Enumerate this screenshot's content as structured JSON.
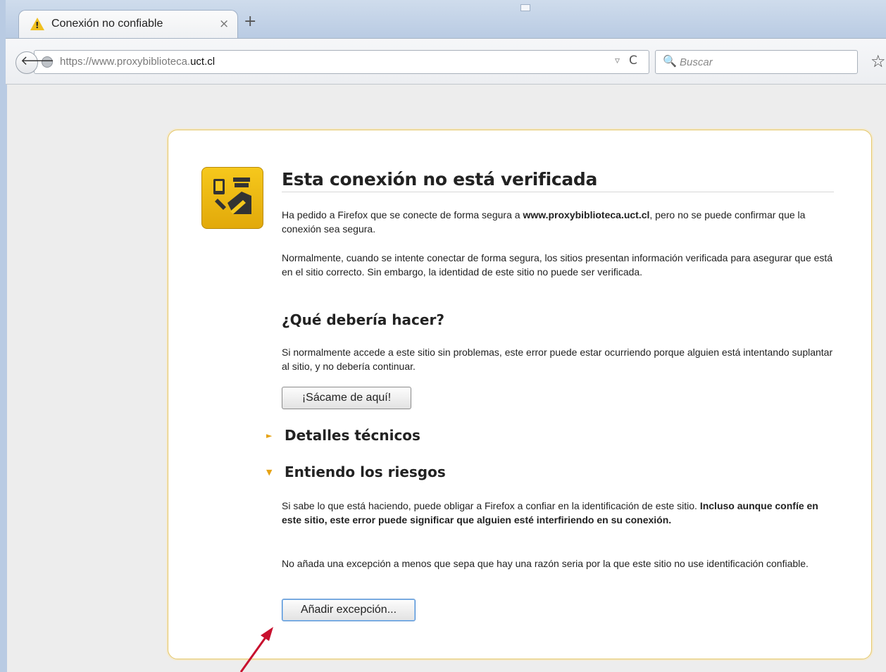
{
  "tab": {
    "title": "Conexión no confiable",
    "close": "×",
    "warn": "!"
  },
  "toolbar": {
    "newtab": "+",
    "back": "🡐",
    "url_prefix": "https://www.proxybiblioteca.",
    "url_host": "uct.cl",
    "dropdown": "▿",
    "reload": "C",
    "search_icon": "🔍",
    "search_placeholder": "Buscar",
    "star": "☆"
  },
  "page": {
    "title": "Esta conexión no está verificada",
    "p1_a": "Ha pedido a Firefox que se conecte de forma segura a ",
    "p1_host": "www.proxybiblioteca.uct.cl",
    "p1_b": ", pero no se puede confirmar que la conexión sea segura.",
    "p2": "Normalmente, cuando se intente conectar de forma segura, los sitios presentan información verificada para asegurar que está en el sitio correcto. Sin embargo, la identidad de este sitio no puede ser verificada.",
    "h_what": "¿Qué debería hacer?",
    "p3": "Si normalmente accede a este sitio sin problemas, este error puede estar ocurriendo porque alguien está intentando suplantar al sitio, y no debería continuar.",
    "btn_get_out": "¡Sácame de aquí!",
    "details_arrow": "►",
    "details": "Detalles técnicos",
    "risks_arrow": "▼",
    "risks": "Entiendo los riesgos",
    "p4_a": "Si sabe lo que está haciendo, puede obligar a Firefox a confiar en la identificación de este sitio. ",
    "p4_b": "Incluso aunque confíe en este sitio, este error puede significar que alguien esté interfiriendo en su conexión.",
    "p5": "No añada una excepción a menos que sepa que hay una razón seria por la que este sitio no use identificación confiable.",
    "btn_add": "Añadir excepción..."
  }
}
